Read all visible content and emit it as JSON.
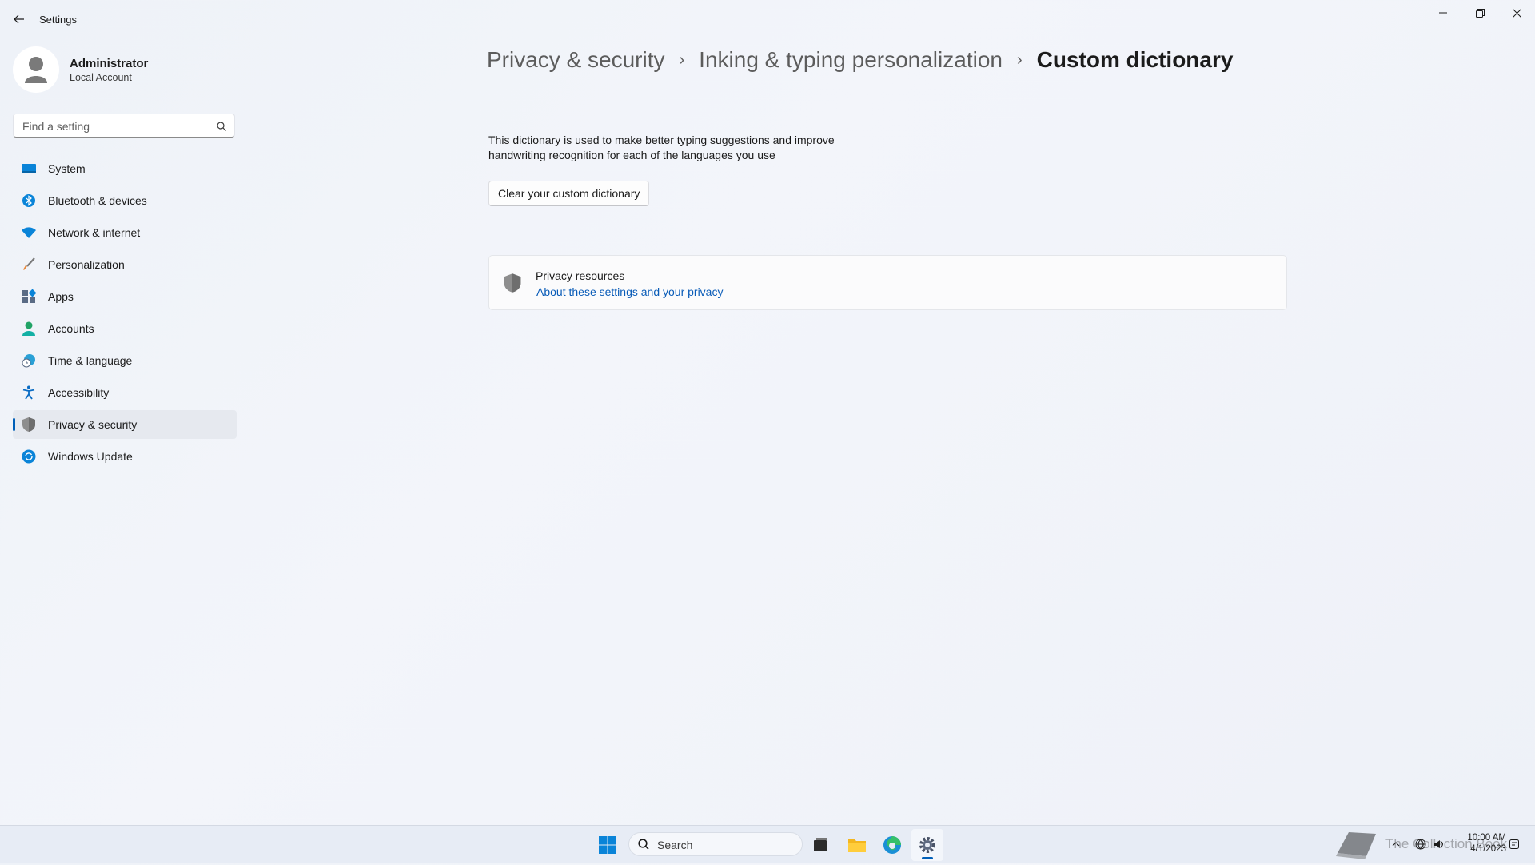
{
  "window": {
    "title": "Settings"
  },
  "profile": {
    "name": "Administrator",
    "account_type": "Local Account"
  },
  "search": {
    "placeholder": "Find a setting"
  },
  "sidebar": {
    "items": [
      {
        "label": "System",
        "icon": "system-icon",
        "active": false
      },
      {
        "label": "Bluetooth & devices",
        "icon": "bluetooth-icon",
        "active": false
      },
      {
        "label": "Network & internet",
        "icon": "wifi-icon",
        "active": false
      },
      {
        "label": "Personalization",
        "icon": "brush-icon",
        "active": false
      },
      {
        "label": "Apps",
        "icon": "apps-icon",
        "active": false
      },
      {
        "label": "Accounts",
        "icon": "accounts-icon",
        "active": false
      },
      {
        "label": "Time & language",
        "icon": "time-language-icon",
        "active": false
      },
      {
        "label": "Accessibility",
        "icon": "accessibility-icon",
        "active": false
      },
      {
        "label": "Privacy & security",
        "icon": "shield-icon",
        "active": true
      },
      {
        "label": "Windows Update",
        "icon": "windows-update-icon",
        "active": false
      }
    ]
  },
  "breadcrumb": {
    "items": [
      "Privacy & security",
      "Inking & typing personalization"
    ],
    "current": "Custom dictionary"
  },
  "main": {
    "description": "This dictionary is used to make better typing suggestions and improve handwriting recognition for each of the languages you use",
    "clear_button": "Clear your custom dictionary",
    "privacy_card": {
      "title": "Privacy resources",
      "link": "About these settings and your privacy"
    }
  },
  "taskbar": {
    "search_label": "Search",
    "apps": [
      "start-icon",
      "task-view-icon",
      "file-explorer-icon",
      "edge-icon",
      "settings-icon"
    ],
    "active_app": "settings-icon",
    "watermark_text": "The Collection Book",
    "clock": {
      "time": "10:00 AM",
      "date": "4/1/2023"
    }
  },
  "colors": {
    "accent": "#005fb8",
    "link": "#0a5cb8",
    "background": "#eef2f8"
  }
}
